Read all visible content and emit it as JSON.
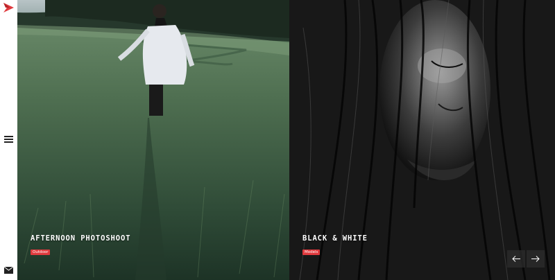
{
  "sidebar": {
    "logo_icon": "arrow-logo-icon",
    "menu_icon": "hamburger-menu-icon",
    "mail_icon": "envelope-icon"
  },
  "slides": [
    {
      "title": "AFTERNOON PHOTOSHOOT",
      "tag": "Outdoor"
    },
    {
      "title": "BLACK & WHITE",
      "tag": "Models"
    }
  ],
  "navigation": {
    "prev_icon": "arrow-left-icon",
    "next_icon": "arrow-right-icon"
  },
  "colors": {
    "accent": "#e03a3e",
    "sidebar_bg": "#ffffff",
    "arrow_bg": "#2d2d2d"
  }
}
